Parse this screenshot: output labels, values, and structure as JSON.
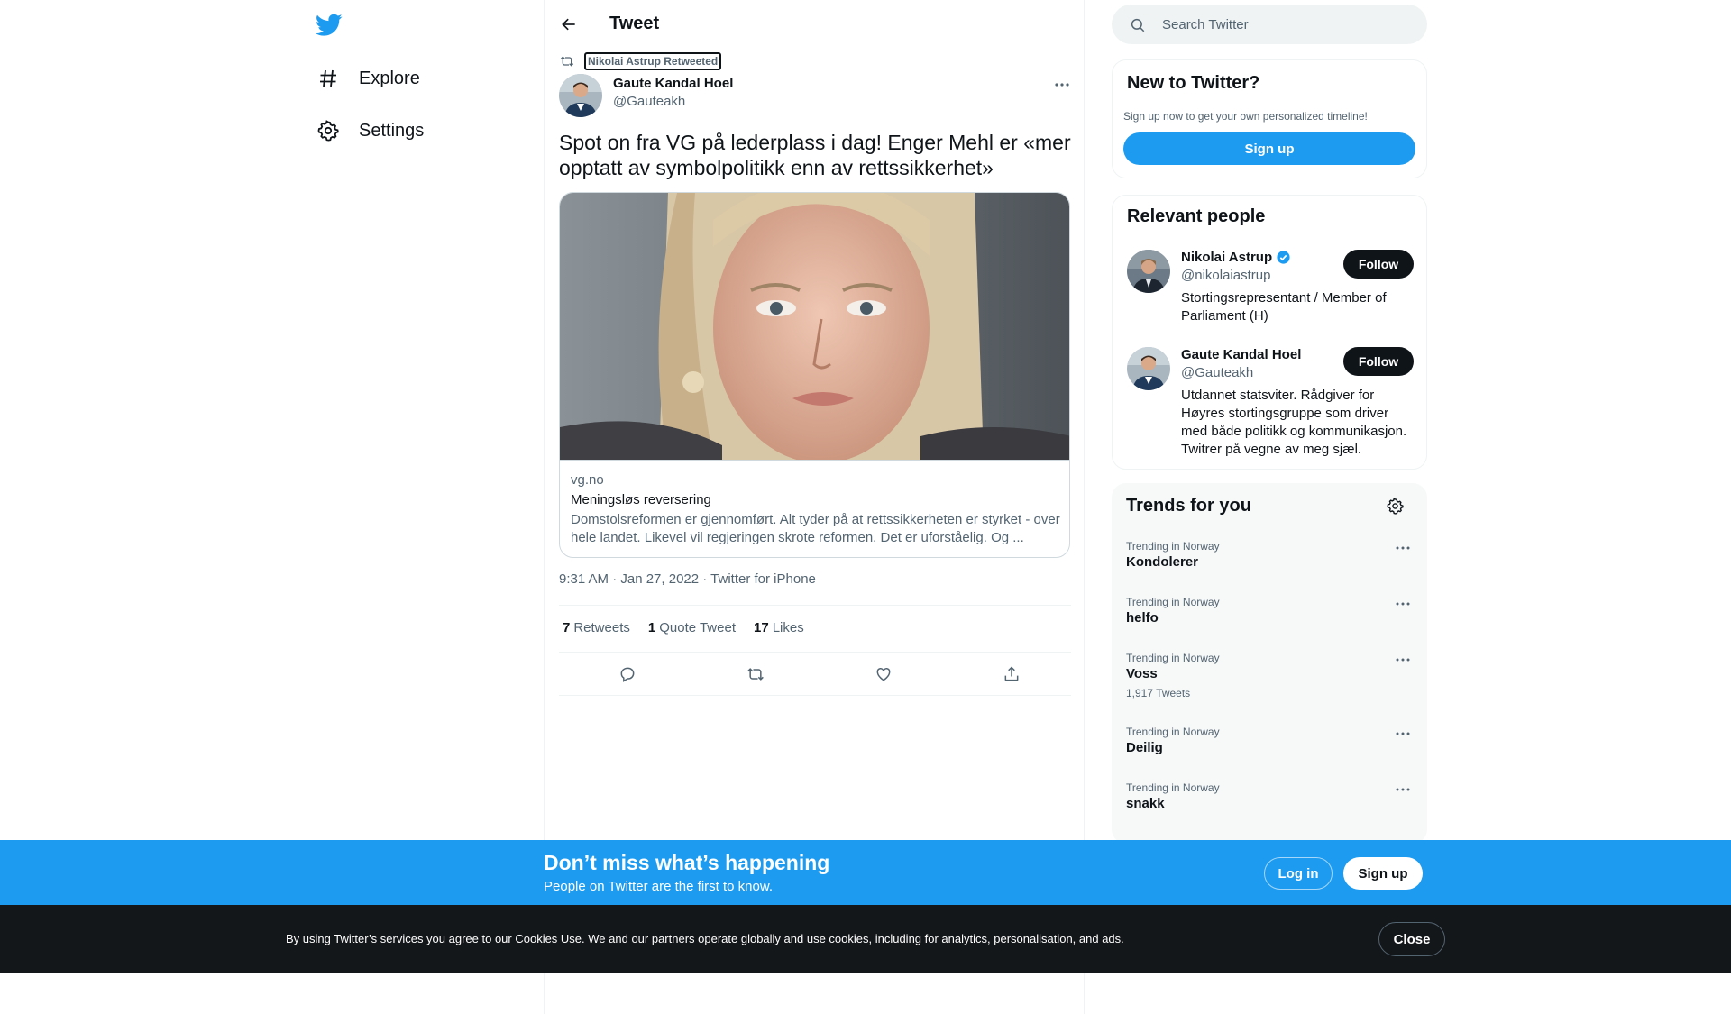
{
  "nav": {
    "items": [
      {
        "label": "Explore",
        "icon": "hashtag-icon"
      },
      {
        "label": "Settings",
        "icon": "gear-icon"
      }
    ]
  },
  "header": {
    "title": "Tweet"
  },
  "tweet": {
    "retweeted_by": "Nikolai Astrup Retweeted",
    "author_name": "Gaute Kandal Hoel",
    "author_handle": "@Gauteakh",
    "text": "Spot on fra VG på lederplass i dag! Enger Mehl er «mer opptatt av symbolpolitikk enn av rettssikkerhet»",
    "card": {
      "domain": "vg.no",
      "title": "Meningsløs reversering",
      "description": "Domstolsreformen er gjennomført. Alt tyder på at rettssikkerheten er styrket - over hele landet. Likevel vil regjeringen skrote reformen. Det er uforståelig. Og ..."
    },
    "meta": "9:31 AM · Jan 27, 2022 · Twitter for iPhone",
    "stats": {
      "retweets": "7",
      "retweets_label": "Retweets",
      "quotes": "1",
      "quotes_label": "Quote Tweet",
      "likes": "17",
      "likes_label": "Likes"
    }
  },
  "search": {
    "placeholder": "Search Twitter"
  },
  "new_to_twitter": {
    "title": "New to Twitter?",
    "subtitle": "Sign up now to get your own personalized timeline!",
    "signup_label": "Sign up"
  },
  "relevant_people": {
    "title": "Relevant people",
    "people": [
      {
        "name": "Nikolai Astrup",
        "handle": "@nikolaiastrup",
        "verified": true,
        "bio": "Stortingsrepresentant / Member of Parliament (H)",
        "follow_label": "Follow"
      },
      {
        "name": "Gaute Kandal Hoel",
        "handle": "@Gauteakh",
        "verified": false,
        "bio": "Utdannet statsviter. Rådgiver for Høyres stortingsgruppe som driver med både politikk og kommunikasjon. Twitrer på vegne av meg sjæl.",
        "follow_label": "Follow"
      }
    ]
  },
  "trends": {
    "title": "Trends for you",
    "items": [
      {
        "category": "Trending in Norway",
        "name": "Kondolerer",
        "count": ""
      },
      {
        "category": "Trending in Norway",
        "name": "helfo",
        "count": ""
      },
      {
        "category": "Trending in Norway",
        "name": "Voss",
        "count": "1,917 Tweets"
      },
      {
        "category": "Trending in Norway",
        "name": "Deilig",
        "count": ""
      },
      {
        "category": "Trending in Norway",
        "name": "snakk",
        "count": ""
      }
    ]
  },
  "banner": {
    "title": "Don’t miss what’s happening",
    "subtitle": "People on Twitter are the first to know.",
    "login_label": "Log in",
    "signup_label": "Sign up"
  },
  "cookie": {
    "text": "By using Twitter’s services you agree to our Cookies Use. We and our partners operate globally and use cookies, including for analytics, personalisation, and ads.",
    "close_label": "Close"
  },
  "colors": {
    "accent": "#1d9bf0",
    "text": "#0f1419",
    "secondary": "#536471",
    "dark": "#14171a"
  }
}
